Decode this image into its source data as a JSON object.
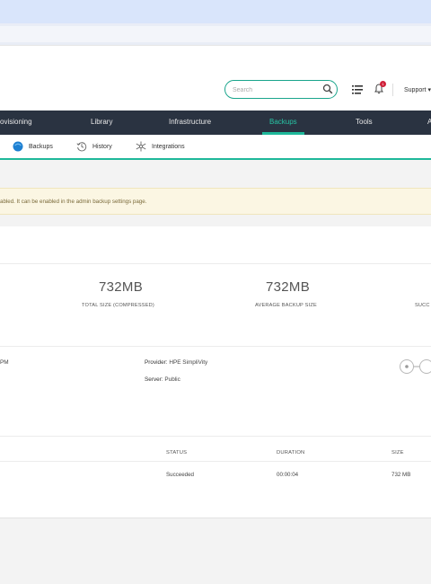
{
  "header": {
    "search_placeholder": "Search",
    "notification_count": "1",
    "support_label": "Support ▾"
  },
  "main_nav": {
    "items": [
      "ovisioning",
      "Library",
      "Infrastructure",
      "Backups",
      "Tools",
      "A"
    ],
    "active": "Backups"
  },
  "sub_nav": {
    "items": [
      "Backups",
      "History",
      "Integrations"
    ]
  },
  "alert": {
    "text": "abled. It can be enabled in the admin backup settings page."
  },
  "stats": {
    "total_size_value": "732MB",
    "total_size_label": "TOTAL SIZE (COMPRESSED)",
    "average_size_value": "732MB",
    "average_size_label": "AVERAGE BACKUP SIZE",
    "success_label": "SUCC"
  },
  "details": {
    "time_fragment": "PM",
    "provider_label": "Provider:",
    "provider_value": "HPE SimpliVity",
    "server_label": "Server:",
    "server_value": "Public"
  },
  "table": {
    "headers": [
      "STATUS",
      "DURATION",
      "SIZE"
    ],
    "rows": [
      {
        "status": "Succeeded",
        "duration": "00:00:04",
        "size": "732 MB"
      }
    ]
  },
  "colors": {
    "accent": "#1eb89a",
    "nav_bg": "#2a3341",
    "alert_bg": "#fbf6e3",
    "badge": "#d0213a"
  }
}
